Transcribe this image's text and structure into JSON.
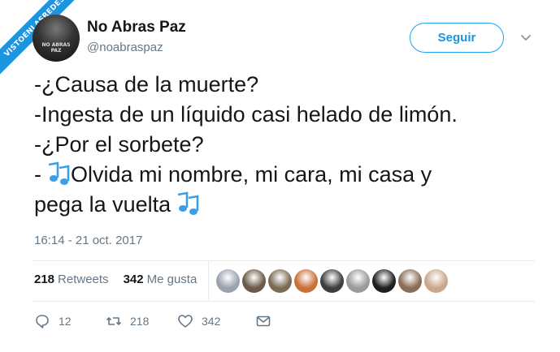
{
  "watermark": {
    "text": "VISTOENLASREDES"
  },
  "author": {
    "avatar_caption": "NO ABRAS PAZ",
    "name": "No Abras Paz",
    "handle": "@noabraspaz"
  },
  "follow_button": {
    "label": "Seguir"
  },
  "tweet": {
    "lines": [
      "-¿Causa de la muerte?",
      "-Ingesta de un líquido casi helado de limón.",
      "-¿Por el sorbete?",
      "Olvida mi nombre, mi cara, mi casa y",
      "pega la vuelta"
    ],
    "line4_prefix": "-",
    "emoji_icon": "musical-notes-icon"
  },
  "timestamp": "16:14 - 21 oct. 2017",
  "stats": {
    "retweets_count": "218",
    "retweets_label": "Retweets",
    "likes_count": "342",
    "likes_label": "Me gusta"
  },
  "liker_colors": [
    "#9aa3ad",
    "#6b5a4a",
    "#7a6b55",
    "#c8703a",
    "#3d3d3d",
    "#9a9a9a",
    "#1f1f1f",
    "#8a6d56",
    "#caa78a"
  ],
  "actions": {
    "reply_count": "12",
    "retweet_count": "218",
    "like_count": "342"
  },
  "colors": {
    "accent": "#1da1f2",
    "secondary_text": "#657786",
    "primary_text": "#14171a"
  }
}
